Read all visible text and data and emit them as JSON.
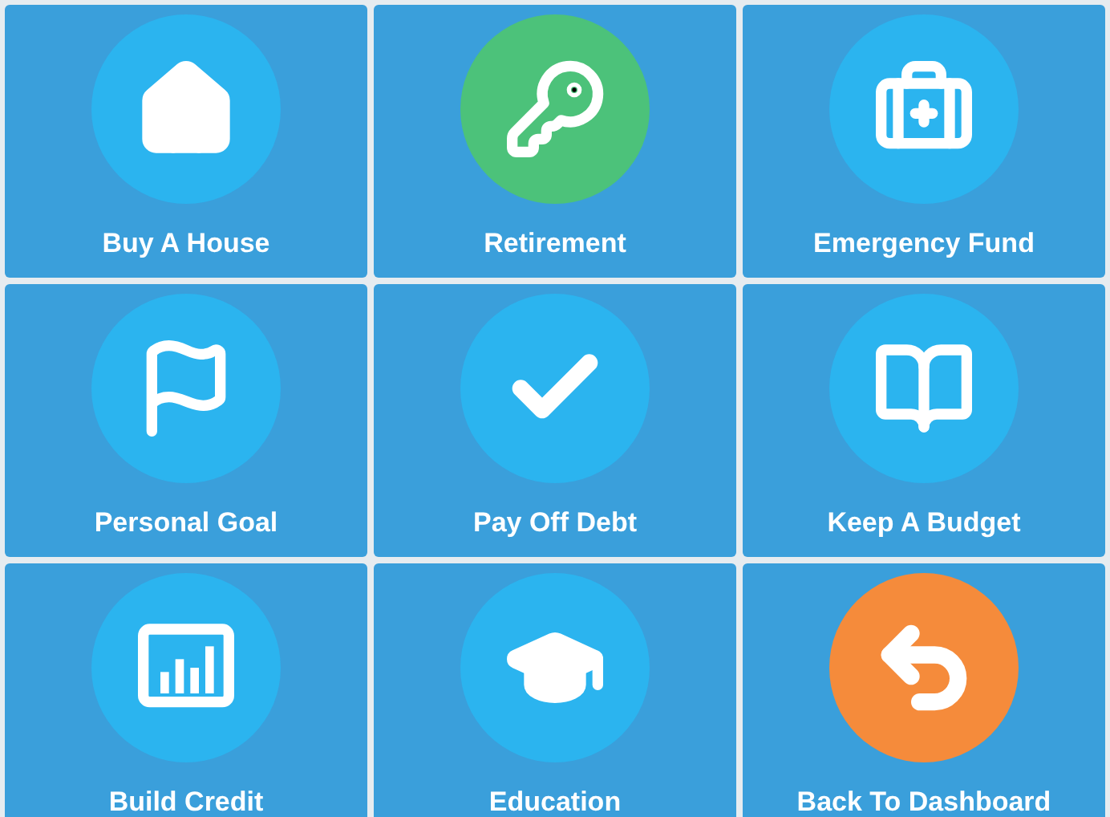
{
  "tiles": [
    {
      "label": "Buy A House",
      "color": "#2bb4ef"
    },
    {
      "label": "Retirement",
      "color": "#4cc27a"
    },
    {
      "label": "Emergency Fund",
      "color": "#2bb4ef"
    },
    {
      "label": "Personal Goal",
      "color": "#2bb4ef"
    },
    {
      "label": "Pay Off Debt",
      "color": "#2bb4ef"
    },
    {
      "label": "Keep A Budget",
      "color": "#2bb4ef"
    },
    {
      "label": "Build Credit",
      "color": "#2bb4ef"
    },
    {
      "label": "Education",
      "color": "#2bb4ef"
    },
    {
      "label": "Back To Dashboard",
      "color": "#f58b3b"
    }
  ]
}
